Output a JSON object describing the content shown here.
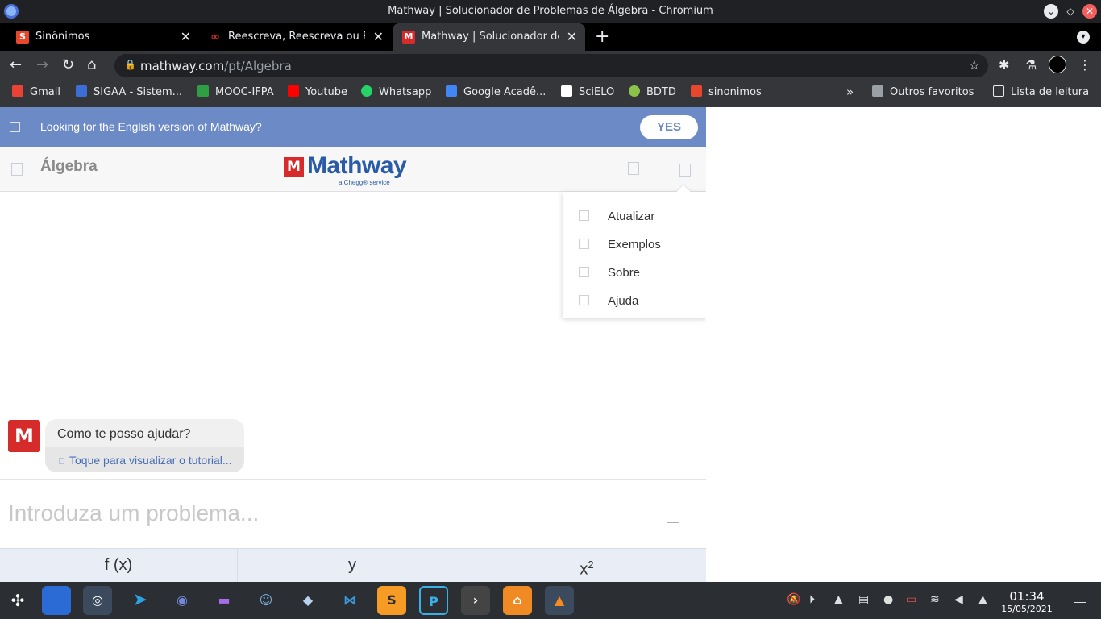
{
  "window": {
    "title": "Mathway | Solucionador de Problemas de Álgebra - Chromium"
  },
  "tabs": [
    {
      "label": "Sinônimos",
      "icon": "s-icon",
      "color": "#e8472b"
    },
    {
      "label": "Reescreva, Reescreva ou R",
      "icon": "rewrite-icon",
      "color": "#d93025"
    },
    {
      "label": "Mathway | Solucionador de",
      "icon": "mathway-icon",
      "color": "#d62b2b"
    }
  ],
  "address": {
    "host": "mathway.com",
    "path": "/pt/Algebra"
  },
  "bookmarks": [
    {
      "label": "Gmail",
      "icon": "gmail-icon",
      "color": "#ea4335"
    },
    {
      "label": "SIGAA - Sistem...",
      "icon": "sigaa-icon",
      "color": "#3b6fd6"
    },
    {
      "label": "MOOC-IFPA",
      "icon": "mooc-icon",
      "color": "#2ea043"
    },
    {
      "label": "Youtube",
      "icon": "youtube-icon",
      "color": "#ff0000"
    },
    {
      "label": "Whatsapp",
      "icon": "whatsapp-icon",
      "color": "#25d366"
    },
    {
      "label": "Google Acadê...",
      "icon": "scholar-icon",
      "color": "#4285f4"
    },
    {
      "label": "SciELO",
      "icon": "scielo-icon",
      "color": "#ffffff"
    },
    {
      "label": "BDTD",
      "icon": "bdtd-icon",
      "color": "#8bc34a"
    },
    {
      "label": "sinonimos",
      "icon": "s-icon",
      "color": "#e8472b"
    }
  ],
  "bookmarks_right": {
    "more": "»",
    "other": "Outros favoritos",
    "reading": "Lista de leitura"
  },
  "banner": {
    "text": "Looking for the English version of Mathway?",
    "button": "YES"
  },
  "header": {
    "subject": "Álgebra",
    "logo_mark": "M",
    "logo_name": "Mathway",
    "logo_sub": "a Chegg® service"
  },
  "menu": {
    "items": [
      "Atualizar",
      "Exemplos",
      "Sobre",
      "Ajuda"
    ]
  },
  "chat": {
    "message": "Como te posso ajudar?",
    "tutorial": "Toque para visualizar o tutorial..."
  },
  "input": {
    "placeholder": "Introduza um problema..."
  },
  "keys": [
    {
      "label": "f (x)"
    },
    {
      "label": "y"
    },
    {
      "label": "x"
    }
  ],
  "keys_sup": "2",
  "taskbar": {
    "apps": [
      "files-icon",
      "chromium-icon",
      "telegram-icon",
      "discord-icon",
      "game-icon",
      "godot-icon",
      "cube-icon",
      "vscode-icon",
      "sublime-icon",
      "p-icon",
      "terminal-icon",
      "uget-icon",
      "vlc-icon"
    ],
    "time": "01:34",
    "date": "15/05/2021"
  },
  "colors": {
    "banner": "#6c8ac5",
    "brand": "#2a5ba8",
    "accent_red": "#d62b2b"
  }
}
